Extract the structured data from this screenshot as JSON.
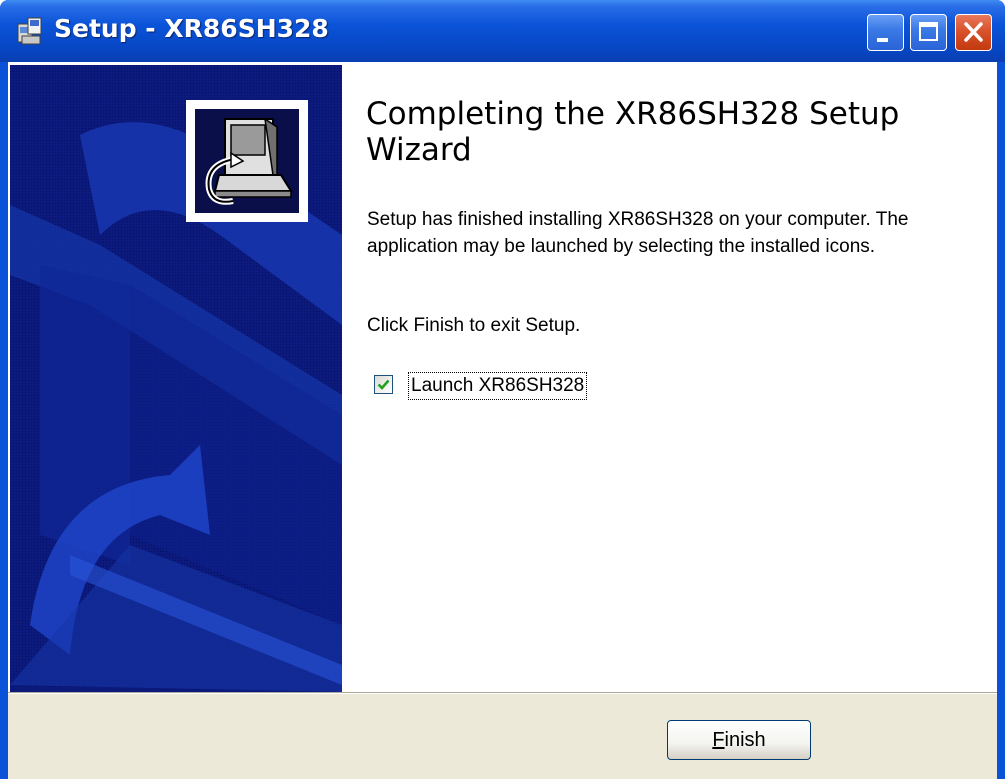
{
  "window": {
    "title": "Setup - XR86SH328"
  },
  "wizard": {
    "heading": "Completing the XR86SH328 Setup Wizard",
    "description": "Setup has finished installing XR86SH328 on your computer. The application may be launched by selecting the installed icons.",
    "hint": "Click Finish to exit Setup.",
    "launch_checkbox": {
      "label": "Launch XR86SH328",
      "checked": true
    }
  },
  "footer": {
    "finish_label_mnemonic": "F",
    "finish_label_rest": "inish"
  },
  "icons": {
    "app": "setup-icon",
    "minimize": "minimize-icon",
    "maximize": "maximize-icon",
    "close": "close-icon",
    "wizard_image": "computer-install-icon",
    "check": "checkmark-icon"
  },
  "colors": {
    "titlebar": "#0a53d8",
    "side_panel": "#0a1673",
    "footer": "#ece9d8",
    "check": "#21a121",
    "close_button": "#d9532c"
  }
}
